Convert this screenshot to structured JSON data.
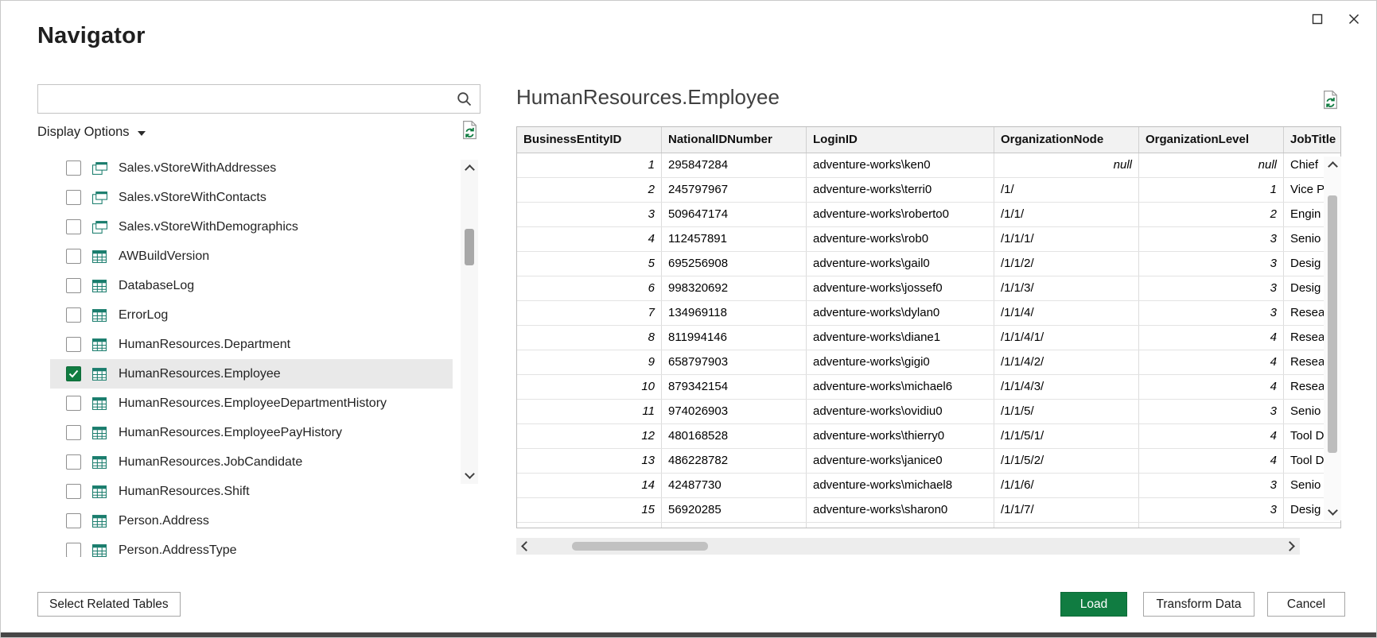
{
  "window": {
    "title": "Navigator"
  },
  "sidebar": {
    "search": {
      "value": "",
      "placeholder": ""
    },
    "display_options_label": "Display Options",
    "items": [
      {
        "label": "Sales.vStoreWithAddresses",
        "type": "view",
        "checked": false,
        "selected": false
      },
      {
        "label": "Sales.vStoreWithContacts",
        "type": "view",
        "checked": false,
        "selected": false
      },
      {
        "label": "Sales.vStoreWithDemographics",
        "type": "view",
        "checked": false,
        "selected": false
      },
      {
        "label": "AWBuildVersion",
        "type": "table",
        "checked": false,
        "selected": false
      },
      {
        "label": "DatabaseLog",
        "type": "table",
        "checked": false,
        "selected": false
      },
      {
        "label": "ErrorLog",
        "type": "table",
        "checked": false,
        "selected": false
      },
      {
        "label": "HumanResources.Department",
        "type": "table",
        "checked": false,
        "selected": false
      },
      {
        "label": "HumanResources.Employee",
        "type": "table",
        "checked": true,
        "selected": true
      },
      {
        "label": "HumanResources.EmployeeDepartmentHistory",
        "type": "table",
        "checked": false,
        "selected": false
      },
      {
        "label": "HumanResources.EmployeePayHistory",
        "type": "table",
        "checked": false,
        "selected": false
      },
      {
        "label": "HumanResources.JobCandidate",
        "type": "table",
        "checked": false,
        "selected": false
      },
      {
        "label": "HumanResources.Shift",
        "type": "table",
        "checked": false,
        "selected": false
      },
      {
        "label": "Person.Address",
        "type": "table",
        "checked": false,
        "selected": false
      },
      {
        "label": "Person.AddressType",
        "type": "table",
        "checked": false,
        "selected": false
      }
    ]
  },
  "preview": {
    "title": "HumanResources.Employee",
    "columns": [
      {
        "label": "BusinessEntityID",
        "align": "right"
      },
      {
        "label": "NationalIDNumber",
        "align": "left"
      },
      {
        "label": "LoginID",
        "align": "left"
      },
      {
        "label": "OrganizationNode",
        "align": "left"
      },
      {
        "label": "OrganizationLevel",
        "align": "right"
      },
      {
        "label": "JobTitle",
        "align": "left"
      }
    ],
    "rows": [
      [
        "1",
        "295847284",
        "adventure-works\\ken0",
        "null",
        "null",
        "Chief"
      ],
      [
        "2",
        "245797967",
        "adventure-works\\terri0",
        "/1/",
        "1",
        "Vice P"
      ],
      [
        "3",
        "509647174",
        "adventure-works\\roberto0",
        "/1/1/",
        "2",
        "Engin"
      ],
      [
        "4",
        "112457891",
        "adventure-works\\rob0",
        "/1/1/1/",
        "3",
        "Senio"
      ],
      [
        "5",
        "695256908",
        "adventure-works\\gail0",
        "/1/1/2/",
        "3",
        "Desig"
      ],
      [
        "6",
        "998320692",
        "adventure-works\\jossef0",
        "/1/1/3/",
        "3",
        "Desig"
      ],
      [
        "7",
        "134969118",
        "adventure-works\\dylan0",
        "/1/1/4/",
        "3",
        "Resea"
      ],
      [
        "8",
        "811994146",
        "adventure-works\\diane1",
        "/1/1/4/1/",
        "4",
        "Resea"
      ],
      [
        "9",
        "658797903",
        "adventure-works\\gigi0",
        "/1/1/4/2/",
        "4",
        "Resea"
      ],
      [
        "10",
        "879342154",
        "adventure-works\\michael6",
        "/1/1/4/3/",
        "4",
        "Resea"
      ],
      [
        "11",
        "974026903",
        "adventure-works\\ovidiu0",
        "/1/1/5/",
        "3",
        "Senio"
      ],
      [
        "12",
        "480168528",
        "adventure-works\\thierry0",
        "/1/1/5/1/",
        "4",
        "Tool D"
      ],
      [
        "13",
        "486228782",
        "adventure-works\\janice0",
        "/1/1/5/2/",
        "4",
        "Tool D"
      ],
      [
        "14",
        "42487730",
        "adventure-works\\michael8",
        "/1/1/6/",
        "3",
        "Senio"
      ],
      [
        "15",
        "56920285",
        "adventure-works\\sharon0",
        "/1/1/7/",
        "3",
        "Desig"
      ]
    ]
  },
  "footer": {
    "select_related_label": "Select Related Tables",
    "load_label": "Load",
    "transform_label": "Transform Data",
    "cancel_label": "Cancel"
  },
  "colors": {
    "accent_green": "#107C41",
    "icon_teal": "#1a7d6d",
    "table_header_bg": "#f2f2f2",
    "selected_row_bg": "#e9e9e9"
  }
}
